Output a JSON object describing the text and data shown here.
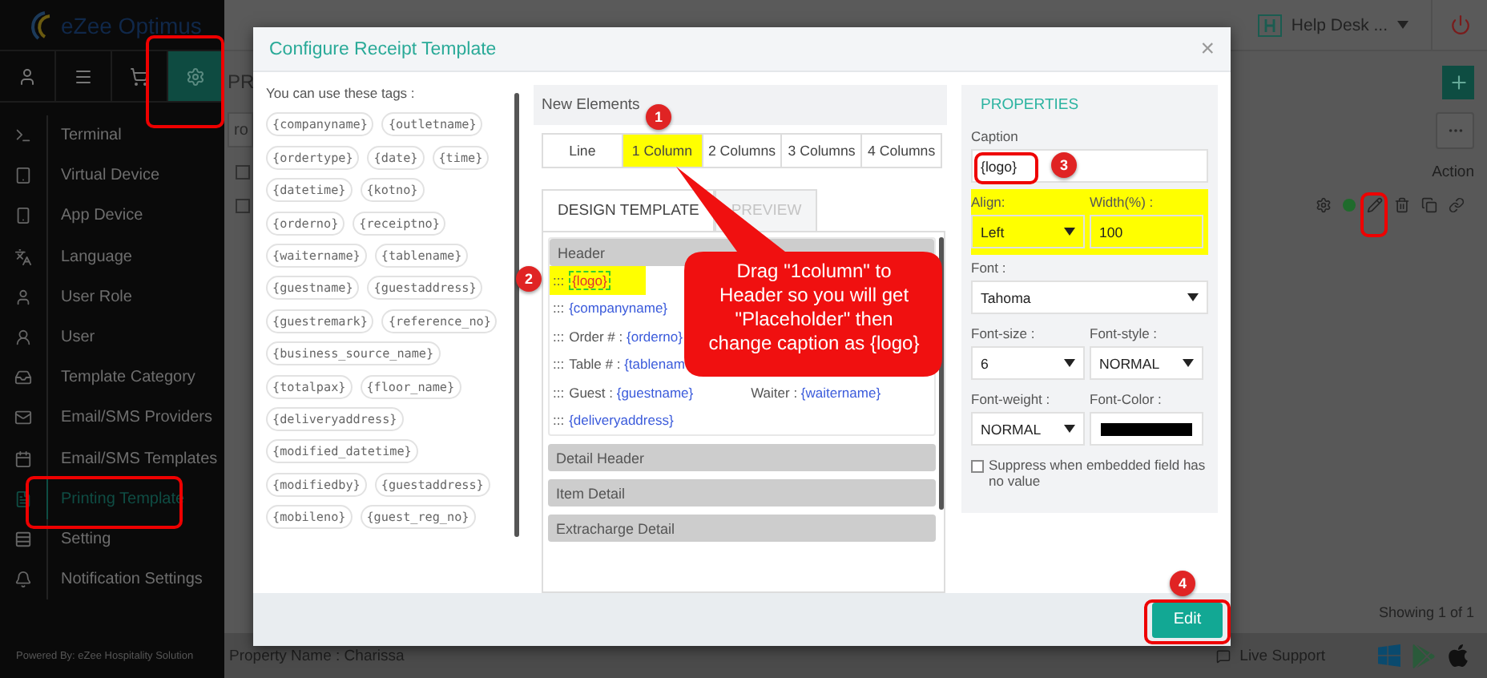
{
  "app": {
    "logo": "eZee Optimus",
    "help_desk": "Help Desk ...",
    "powered_by": "Powered By: eZee Hospitality Solution"
  },
  "sidebar": {
    "tabs": [
      {
        "selected": false
      },
      {
        "selected": false
      },
      {
        "selected": false
      },
      {
        "selected": true
      }
    ],
    "items": [
      {
        "label": "Terminal",
        "selected": false
      },
      {
        "label": "Virtual Device",
        "selected": false
      },
      {
        "label": "App Device",
        "selected": false
      },
      {
        "label": "Language",
        "selected": false
      },
      {
        "label": "User Role",
        "selected": false
      },
      {
        "label": "User",
        "selected": false
      },
      {
        "label": "Template Category",
        "selected": false
      },
      {
        "label": "Email/SMS Providers",
        "selected": false
      },
      {
        "label": "Email/SMS Templates",
        "selected": false
      },
      {
        "label": "Printing Template",
        "selected": true
      },
      {
        "label": "Setting",
        "selected": false
      },
      {
        "label": "Notification Settings",
        "selected": false
      }
    ]
  },
  "page": {
    "title": "PR",
    "filter": "ro",
    "checkboxes": [
      {
        "checked": false
      },
      {
        "checked": false
      }
    ],
    "action_header": "Action",
    "pagination": "Showing 1 of 1",
    "property": "Property Name : Charissa",
    "live_support": "Live Support"
  },
  "dialog": {
    "title": "Configure Receipt Template",
    "close": "×",
    "tags_intro": "You can use these tags :",
    "tag_rows": [
      [
        "{companyname}",
        "{outletname}"
      ],
      [
        "{ordertype}",
        "{date}",
        "{time}"
      ],
      [
        "{datetime}",
        "{kotno}"
      ],
      [
        "{orderno}",
        "{receiptno}"
      ],
      [
        "{waitername}",
        "{tablename}"
      ],
      [
        "{guestname}",
        "{guestaddress}"
      ],
      [
        "{guestremark}",
        "{reference_no}"
      ],
      [
        "{business_source_name}"
      ],
      [
        "{totalpax}",
        "{floor_name}"
      ],
      [
        "{deliveryaddress}"
      ],
      [
        "{modified_datetime}"
      ],
      [
        "{modifiedby}",
        "{guestaddress}"
      ],
      [
        "{mobileno}",
        "{guest_reg_no}"
      ]
    ],
    "new_elements_title": "New Elements",
    "elements": [
      {
        "label": "Line",
        "highlighted": false
      },
      {
        "label": "1 Column",
        "highlighted": true
      },
      {
        "label": "2 Columns",
        "highlighted": false
      },
      {
        "label": "3 Columns",
        "highlighted": false
      },
      {
        "label": "4 Columns",
        "highlighted": false
      }
    ],
    "tabs": [
      {
        "label": "DESIGN TEMPLATE",
        "selected": true
      },
      {
        "label": "PREVIEW",
        "selected": false
      }
    ],
    "sections": [
      {
        "title": "Header",
        "rows": [
          {
            "handle": ":::",
            "highlighted": true,
            "cells": [
              {
                "tag": "{logo}",
                "kind": "placeholder"
              }
            ]
          },
          {
            "handle": ":::",
            "highlighted": false,
            "cells": [
              {
                "tag": "{companyname}",
                "kind": "field"
              }
            ]
          },
          {
            "handle": ":::",
            "highlighted": false,
            "cells": [
              {
                "label": "Order # :",
                "tag": "{orderno}",
                "kind": "field"
              }
            ]
          },
          {
            "handle": ":::",
            "highlighted": false,
            "cells": [
              {
                "label": "Table # :",
                "tag": "{tablenam",
                "kind": "field"
              }
            ]
          },
          {
            "handle": ":::",
            "highlighted": false,
            "cells": [
              {
                "label": "Guest :",
                "tag": "{guestname}",
                "kind": "field"
              },
              {
                "label": "Waiter :",
                "tag": "{waitername}",
                "kind": "field"
              }
            ]
          },
          {
            "handle": ":::",
            "highlighted": false,
            "cells": [
              {
                "tag": "{deliveryaddress}",
                "kind": "field"
              }
            ]
          }
        ]
      },
      {
        "title": "Detail Header"
      },
      {
        "title": "Item Detail"
      },
      {
        "title": "Extracharge Detail"
      }
    ],
    "properties": {
      "title": "PROPERTIES",
      "fields": [
        {
          "label": "Caption",
          "kind": "text",
          "value": "{logo}",
          "wide": true,
          "highlighted": false
        },
        {
          "label": "Align:",
          "kind": "select",
          "value": "Left",
          "wide": false,
          "highlighted": true
        },
        {
          "label": "Width(%) :",
          "kind": "text",
          "value": "100",
          "wide": false,
          "highlighted": true
        },
        {
          "label": "Font :",
          "kind": "select",
          "value": "Tahoma",
          "wide": true,
          "highlighted": false
        },
        {
          "label": "Font-size :",
          "kind": "select",
          "value": "6",
          "wide": false,
          "highlighted": false
        },
        {
          "label": "Font-style :",
          "kind": "select",
          "value": "NORMAL",
          "wide": false,
          "highlighted": false
        },
        {
          "label": "Font-weight :",
          "kind": "select",
          "value": "NORMAL",
          "wide": false,
          "highlighted": false
        },
        {
          "label": "Font-Color :",
          "kind": "color",
          "color": "#000000",
          "wide": false,
          "highlighted": false
        }
      ],
      "suppress": {
        "label": "Suppress when embedded field has no value",
        "checked": false
      }
    },
    "edit_button": "Edit"
  },
  "callout": "Drag \"1column\" to Header so you will get \"Placeholder\" then change caption as {logo}",
  "markers": [
    "1",
    "2",
    "3",
    "4"
  ]
}
